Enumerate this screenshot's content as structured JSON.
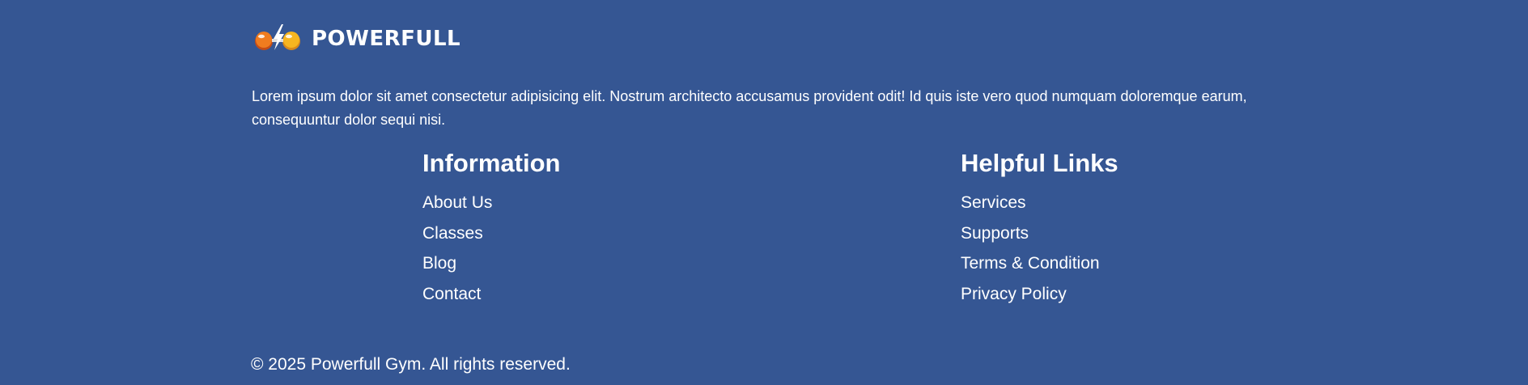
{
  "brand": {
    "name": "POWERFULL",
    "logo_icon": "dumbbell-lightning-icon",
    "colors": {
      "background": "#355693",
      "text": "#ffffff",
      "logo_orange": "#f07c1f",
      "logo_orange_dark": "#c54d16",
      "logo_yellow": "#f6b520"
    }
  },
  "about": {
    "text": "Lorem ipsum dolor sit amet consectetur adipisicing elit. Nostrum architecto accusamus provident odit! Id quis iste vero quod numquam doloremque earum, consequuntur dolor sequi nisi."
  },
  "information": {
    "title": "Information",
    "links": [
      "About Us",
      "Classes",
      "Blog",
      "Contact"
    ]
  },
  "helpful_links": {
    "title": "Helpful Links",
    "links": [
      "Services",
      "Supports",
      "Terms & Condition",
      "Privacy Policy"
    ]
  },
  "copyright": {
    "text": "© 2025 Powerfull Gym. All rights reserved."
  }
}
